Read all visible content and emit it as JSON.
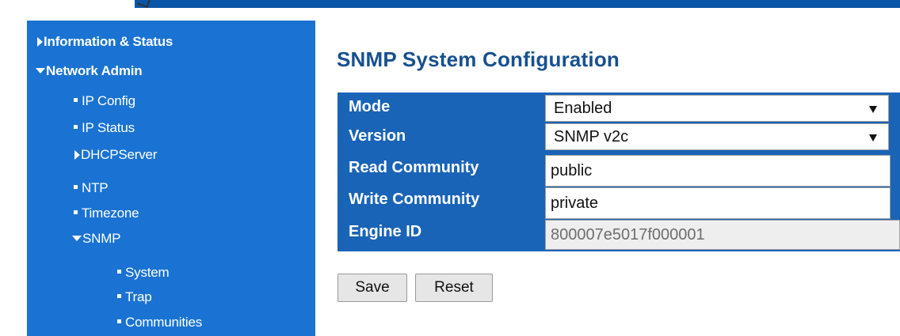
{
  "sidebar": {
    "items": [
      {
        "label": "Information & Status",
        "icon": "triangle-right-icon"
      },
      {
        "label": "Network Admin",
        "icon": "triangle-down-icon"
      },
      {
        "label": "IP Config",
        "icon": "bullet-icon"
      },
      {
        "label": "IP Status",
        "icon": "bullet-icon"
      },
      {
        "label": "DHCPServer",
        "icon": "triangle-right-icon"
      },
      {
        "label": "NTP",
        "icon": "bullet-icon"
      },
      {
        "label": "Timezone",
        "icon": "bullet-icon"
      },
      {
        "label": "SNMP",
        "icon": "triangle-down-icon"
      },
      {
        "label": "System",
        "icon": "bullet-icon"
      },
      {
        "label": "Trap",
        "icon": "bullet-icon"
      },
      {
        "label": "Communities",
        "icon": "bullet-icon"
      }
    ]
  },
  "main": {
    "title": "SNMP System Configuration",
    "form": {
      "mode_label": "Mode",
      "mode_value": "Enabled",
      "version_label": "Version",
      "version_value": "SNMP v2c",
      "read_community_label": "Read Community",
      "read_community_value": "public",
      "write_community_label": "Write Community",
      "write_community_value": "private",
      "engine_id_label": "Engine ID",
      "engine_id_value": "800007e5017f000001"
    },
    "buttons": {
      "save_label": "Save",
      "reset_label": "Reset"
    }
  },
  "colors": {
    "sidebar_bg": "#1a73d3",
    "table_bg": "#1a64b8",
    "title_color": "#17508f",
    "top_bar": "#0a55a6"
  }
}
